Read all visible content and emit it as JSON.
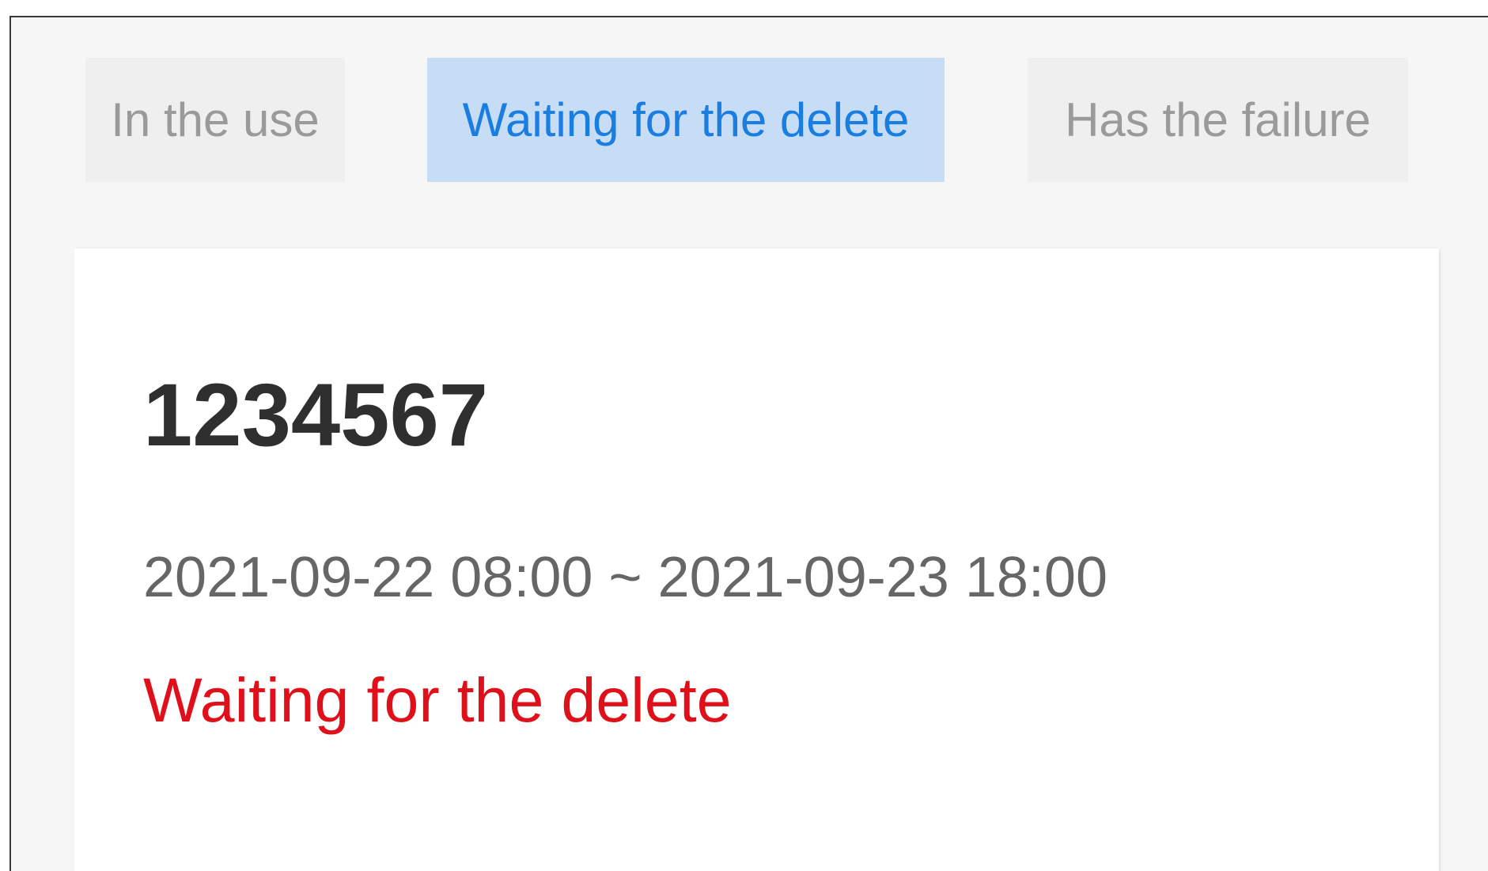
{
  "tabs": [
    {
      "label": "In the use",
      "active": false
    },
    {
      "label": "Waiting for the delete",
      "active": true
    },
    {
      "label": "Has the failure",
      "active": false
    }
  ],
  "card": {
    "id": "1234567",
    "time_range": "2021-09-22 08:00 ~ 2021-09-23 18:00",
    "status": "Waiting for the delete"
  },
  "colors": {
    "active_tab_bg": "#c7ddf6",
    "active_tab_text": "#1a7de0",
    "inactive_tab_bg": "#efefef",
    "inactive_tab_text": "#9a9a9a",
    "status_text": "#e0101a"
  }
}
